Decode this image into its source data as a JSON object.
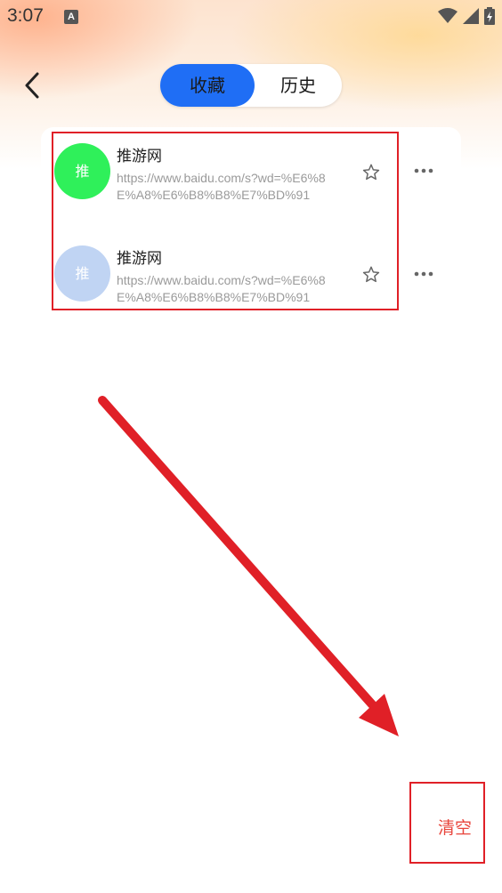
{
  "status_bar": {
    "time": "3:07",
    "badge": "A"
  },
  "nav": {
    "tabs": [
      {
        "label": "收藏",
        "active": true
      },
      {
        "label": "历史",
        "active": false
      }
    ]
  },
  "items": [
    {
      "avatar_text": "推",
      "avatar_color": "#2ff05a",
      "title": "推游网",
      "url": "https://www.baidu.com/s?wd=%E6%8E%A8%E6%B8%B8%E7%BD%91"
    },
    {
      "avatar_text": "推",
      "avatar_color": "#c0d4f3",
      "title": "推游网",
      "url": "https://www.baidu.com/s?wd=%E6%8E%A8%E6%B8%B8%E7%BD%91"
    }
  ],
  "footer": {
    "clear_label": "清空"
  },
  "colors": {
    "accent": "#1f6ef5",
    "annotation_red": "#e02027",
    "clear_text": "#e8453c"
  },
  "icons": {
    "back": "chevron-left-icon",
    "star": "star-outline-icon",
    "more": "more-horizontal-icon"
  }
}
